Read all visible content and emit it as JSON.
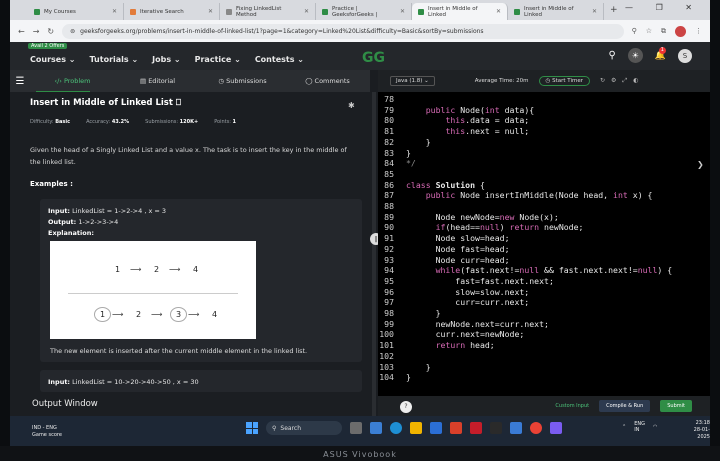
{
  "browser": {
    "tabs": [
      {
        "label": "My Courses",
        "color": "#2f8d46"
      },
      {
        "label": "Iterative Search",
        "color": "#e27b3a"
      },
      {
        "label": "Fixing LinkedList Method",
        "color": "#888888"
      },
      {
        "label": "Practice | GeeksforGeeks |",
        "color": "#2f8d46"
      },
      {
        "label": "Insert in Middle of Linked",
        "color": "#2f8d46",
        "active": true
      },
      {
        "label": "Insert in Middle of Linked",
        "color": "#2f8d46"
      }
    ],
    "new_tab": "+",
    "window_controls": "— ❐ ✕",
    "url": "geeksforgeeks.org/problems/insert-in-middle-of-linked-list/1?page=1&category=Linked%20List&difficulty=Basic&sortBy=submissions"
  },
  "gfg": {
    "offer": "Avail 2 Offers",
    "nav": [
      "Courses",
      "Tutorials",
      "Jobs",
      "Practice",
      "Contests"
    ],
    "logo": "GG",
    "notification_count": "1",
    "avatar_letter": "S"
  },
  "problem_tabs": [
    "Problem",
    "Editorial",
    "Submissions",
    "Comments"
  ],
  "problem": {
    "title": "Insert in Middle of Linked List",
    "difficulty_label": "Difficulty:",
    "difficulty": "Basic",
    "accuracy_label": "Accuracy:",
    "accuracy": "43.2%",
    "submissions_label": "Submissions:",
    "submissions": "120K+",
    "points_label": "Points:",
    "points": "1",
    "description": "Given the head of a Singly Linked List and a value x. The task is to insert the key in the middle of the linked list.",
    "examples_heading": "Examples :",
    "example1": {
      "input_label": "Input:",
      "input": "LinkedList = 1->2->4 , x = 3",
      "output_label": "Output:",
      "output": "1->2->3->4",
      "explanation_label": "Explanation:",
      "diagram_top": [
        "1",
        "2",
        "4"
      ],
      "diagram_bottom": [
        "1",
        "2",
        "3",
        "4"
      ],
      "note": "The new element is inserted after the current middle element in the linked list."
    },
    "example2": {
      "input_label": "Input:",
      "input": "LinkedList = 10->20->40->50 , x = 30"
    }
  },
  "output_window": {
    "title": "Output Window"
  },
  "editor": {
    "language": "Java (1.8)",
    "average_time": "Average Time: 20m",
    "start_timer": "Start Timer",
    "lines": [
      {
        "n": "78",
        "html": ""
      },
      {
        "n": "79",
        "html": "    <span class='kw'>public</span> Node(<span class='ty'>int</span> data){"
      },
      {
        "n": "80",
        "html": "        <span class='kw'>this</span>.data = data;"
      },
      {
        "n": "81",
        "html": "        <span class='kw'>this</span>.next = null;"
      },
      {
        "n": "82",
        "html": "    }"
      },
      {
        "n": "83",
        "html": "}"
      },
      {
        "n": "84",
        "html": "<span class='cm'>*/</span>"
      },
      {
        "n": "85",
        "html": ""
      },
      {
        "n": "86",
        "html": "<span class='kw'>class</span> <b>Solution</b> {"
      },
      {
        "n": "87",
        "html": "    <span class='kw'>public</span> Node insertInMiddle(Node head, <span class='ty'>int</span> x) {"
      },
      {
        "n": "88",
        "html": ""
      },
      {
        "n": "89",
        "html": "      Node newNode=<span class='kw'>new</span> Node(x);"
      },
      {
        "n": "90",
        "html": "      <span class='kw'>if</span>(head==<span class='nl'>null</span>) <span class='kw'>return</span> newNode;"
      },
      {
        "n": "91",
        "html": "      Node slow=head;"
      },
      {
        "n": "92",
        "html": "      Node fast=head;"
      },
      {
        "n": "93",
        "html": "      Node curr=head;"
      },
      {
        "n": "94",
        "html": "      <span class='kw'>while</span>(fast.next!=<span class='nl'>null</span> &amp;&amp; fast.next.next!=<span class='nl'>null</span>) {"
      },
      {
        "n": "95",
        "html": "          fast=fast.next.next;"
      },
      {
        "n": "96",
        "html": "          slow=slow.next;"
      },
      {
        "n": "97",
        "html": "          curr=curr.next;"
      },
      {
        "n": "98",
        "html": "      }"
      },
      {
        "n": "99",
        "html": "      newNode.next=curr.next;"
      },
      {
        "n": "100",
        "html": "      curr.next=newNode;"
      },
      {
        "n": "101",
        "html": "      <span class='kw'>return</span> head;"
      },
      {
        "n": "102",
        "html": ""
      },
      {
        "n": "103",
        "html": "    }"
      },
      {
        "n": "104",
        "html": "}"
      }
    ],
    "custom_input": "Custom Input",
    "compile_run": "Compile & Run",
    "submit": "Submit"
  },
  "taskbar": {
    "keyboard": "IND - ENG",
    "keyboard_sub": "Game score",
    "search": "Search",
    "lang": "ENG",
    "lang_sub": "IN",
    "time": "23:18",
    "date": "28-01-2025"
  },
  "laptop_brand": "ASUS Vivobook"
}
